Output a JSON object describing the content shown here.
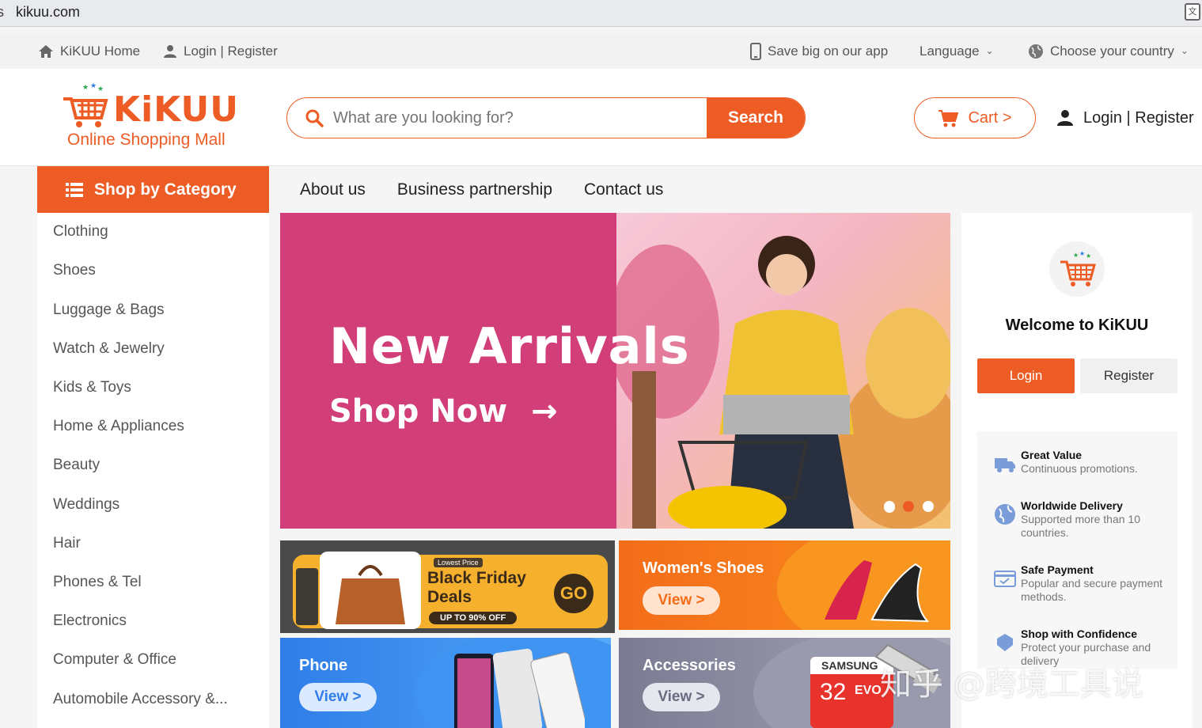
{
  "browser": {
    "url": "kikuu.com",
    "lead_char": "s"
  },
  "topbar": {
    "home": "KiKUU Home",
    "login": "Login | Register",
    "app": "Save big on our app",
    "language": "Language",
    "country": "Choose your country"
  },
  "header": {
    "brand": "KiKUU",
    "tagline": "Online Shopping Mall",
    "search_placeholder": "What are you looking for?",
    "search_button": "Search",
    "cart": "Cart >",
    "login": "Login | Register"
  },
  "nav": {
    "category_button": "Shop by Category",
    "links": [
      "About us",
      "Business partnership",
      "Contact us"
    ]
  },
  "categories": [
    "Clothing",
    "Shoes",
    "Luggage & Bags",
    "Watch & Jewelry",
    "Kids & Toys",
    "Home & Appliances",
    "Beauty",
    "Weddings",
    "Hair",
    "Phones & Tel",
    "Electronics",
    "Computer & Office",
    "Automobile Accessory &..."
  ],
  "banner": {
    "headline": "New Arrivals",
    "cta": "Shop Now",
    "active_slide": 2,
    "slide_count": 3
  },
  "tiles": {
    "black_friday": {
      "badge": "Lowest Price",
      "line1": "Black Friday",
      "line2": "Deals",
      "offer": "UP TO 90% OFF",
      "go": "GO"
    },
    "womens_shoes": {
      "title": "Women's Shoes",
      "view": "View >"
    },
    "phone": {
      "title": "Phone",
      "view": "View >"
    },
    "accessories": {
      "title": "Accessories",
      "view": "View >",
      "card_brand": "SAMSUNG",
      "card_size": "32",
      "card_model": "EVO"
    }
  },
  "panel": {
    "welcome": "Welcome to KiKUU",
    "login": "Login",
    "register": "Register",
    "features": [
      {
        "title": "Great Value",
        "desc": "Continuous promotions."
      },
      {
        "title": "Worldwide Delivery",
        "desc": "Supported more than 10 countries."
      },
      {
        "title": "Safe Payment",
        "desc": "Popular and secure payment methods."
      },
      {
        "title": "Shop with Confidence",
        "desc": "Protect your purchase and delivery"
      }
    ]
  },
  "watermark": "知乎 @跨境工具说",
  "colors": {
    "accent": "#ec5c24",
    "banner_pink": "#d23f78",
    "phone_blue": "#3d8ef0",
    "accessories_grey": "#8a8aa0"
  }
}
